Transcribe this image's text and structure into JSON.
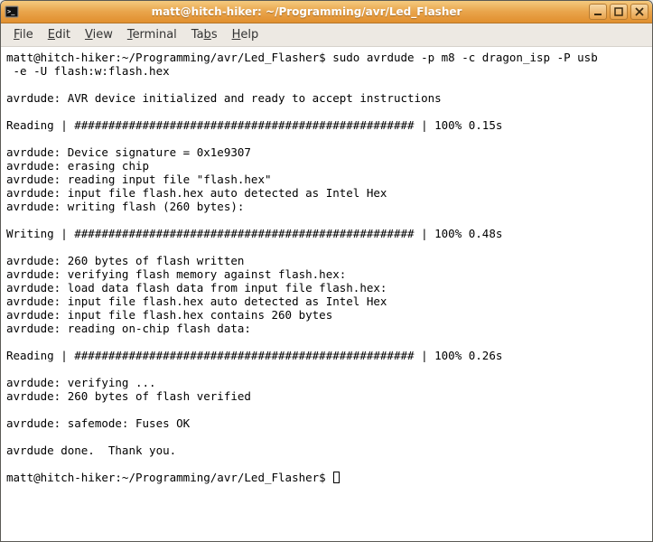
{
  "window": {
    "title": "matt@hitch-hiker: ~/Programming/avr/Led_Flasher"
  },
  "menubar": {
    "file": "File",
    "edit": "Edit",
    "view": "View",
    "terminal": "Terminal",
    "tabs": "Tabs",
    "help": "Help"
  },
  "terminal": {
    "prompt1": "matt@hitch-hiker:~/Programming/avr/Led_Flasher$ ",
    "cmd": "sudo avrdude -p m8 -c dragon_isp -P usb",
    "cmd2": " -e -U flash:w:flash.hex",
    "l_blank": "",
    "l_init": "avrdude: AVR device initialized and ready to accept instructions",
    "l_read1": "Reading | ################################################## | 100% 0.15s",
    "l_sig": "avrdude: Device signature = 0x1e9307",
    "l_erase": "avrdude: erasing chip",
    "l_read_input": "avrdude: reading input file \"flash.hex\"",
    "l_auto1": "avrdude: input file flash.hex auto detected as Intel Hex",
    "l_write": "avrdude: writing flash (260 bytes):",
    "l_writing": "Writing | ################################################## | 100% 0.48s",
    "l_written": "avrdude: 260 bytes of flash written",
    "l_verify1": "avrdude: verifying flash memory against flash.hex:",
    "l_load": "avrdude: load data flash data from input file flash.hex:",
    "l_auto2": "avrdude: input file flash.hex auto detected as Intel Hex",
    "l_contains": "avrdude: input file flash.hex contains 260 bytes",
    "l_read_chip": "avrdude: reading on-chip flash data:",
    "l_read2": "Reading | ################################################## | 100% 0.26s",
    "l_verifying": "avrdude: verifying ...",
    "l_verified": "avrdude: 260 bytes of flash verified",
    "l_fuses": "avrdude: safemode: Fuses OK",
    "l_done": "avrdude done.  Thank you.",
    "prompt2": "matt@hitch-hiker:~/Programming/avr/Led_Flasher$ "
  }
}
